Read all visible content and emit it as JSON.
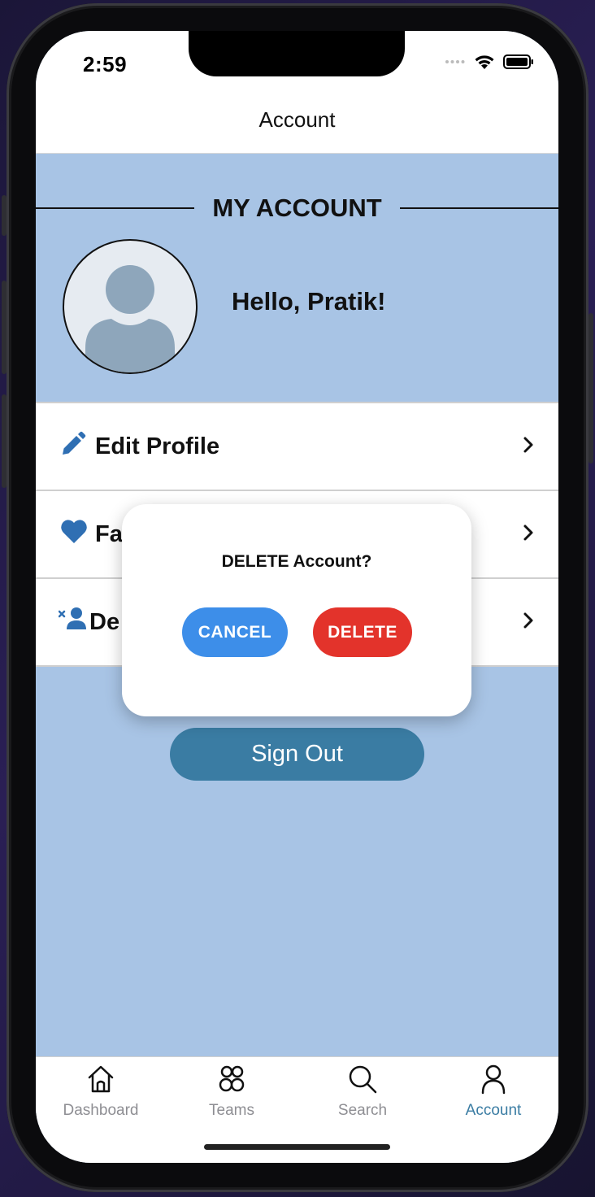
{
  "status_bar": {
    "time": "2:59"
  },
  "nav": {
    "title": "Account"
  },
  "account": {
    "section_heading": "MY ACCOUNT",
    "greeting": "Hello, Pratik!"
  },
  "menu": {
    "items": [
      {
        "label": "Edit Profile",
        "icon": "pencil-icon"
      },
      {
        "label": "Fa",
        "icon": "heart-icon"
      },
      {
        "label": "De",
        "icon": "remove-user-icon"
      }
    ]
  },
  "sign_out": {
    "label": "Sign Out"
  },
  "dialog": {
    "title": "DELETE Account?",
    "cancel_label": "CANCEL",
    "delete_label": "DELETE"
  },
  "tabbar": {
    "tabs": [
      {
        "label": "Dashboard",
        "icon": "home-icon",
        "active": false
      },
      {
        "label": "Teams",
        "icon": "teams-icon",
        "active": false
      },
      {
        "label": "Search",
        "icon": "search-icon",
        "active": false
      },
      {
        "label": "Account",
        "icon": "account-icon",
        "active": true
      }
    ]
  },
  "colors": {
    "background": "#a8c4e5",
    "accent": "#3a7ca3",
    "icon_blue": "#2f6fb3",
    "cancel": "#3d8ee9",
    "delete": "#e3332b"
  }
}
